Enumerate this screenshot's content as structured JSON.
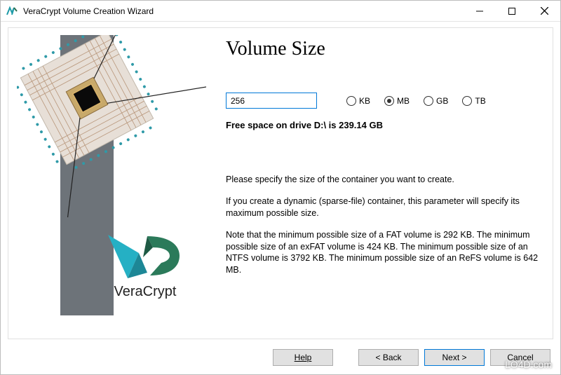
{
  "window": {
    "title": "VeraCrypt Volume Creation Wizard"
  },
  "page": {
    "heading": "Volume Size",
    "size_value": "256",
    "units": {
      "kb": "KB",
      "mb": "MB",
      "gb": "GB",
      "tb": "TB",
      "selected": "MB"
    },
    "free_space": "Free space on drive D:\\ is 239.14 GB",
    "para1": "Please specify the size of the container you want to create.",
    "para2": "If you create a dynamic (sparse-file) container, this parameter will specify its maximum possible size.",
    "para3": "Note that the minimum possible size of a FAT volume is 292 KB. The minimum possible size of an exFAT volume is 424 KB. The minimum possible size of an NTFS volume is 3792 KB. The minimum possible size of an ReFS volume is 642 MB."
  },
  "buttons": {
    "help": "Help",
    "back": "< Back",
    "next": "Next >",
    "cancel": "Cancel"
  },
  "branding": {
    "logo_text": "VeraCrypt"
  },
  "watermark": "LO4D.com"
}
